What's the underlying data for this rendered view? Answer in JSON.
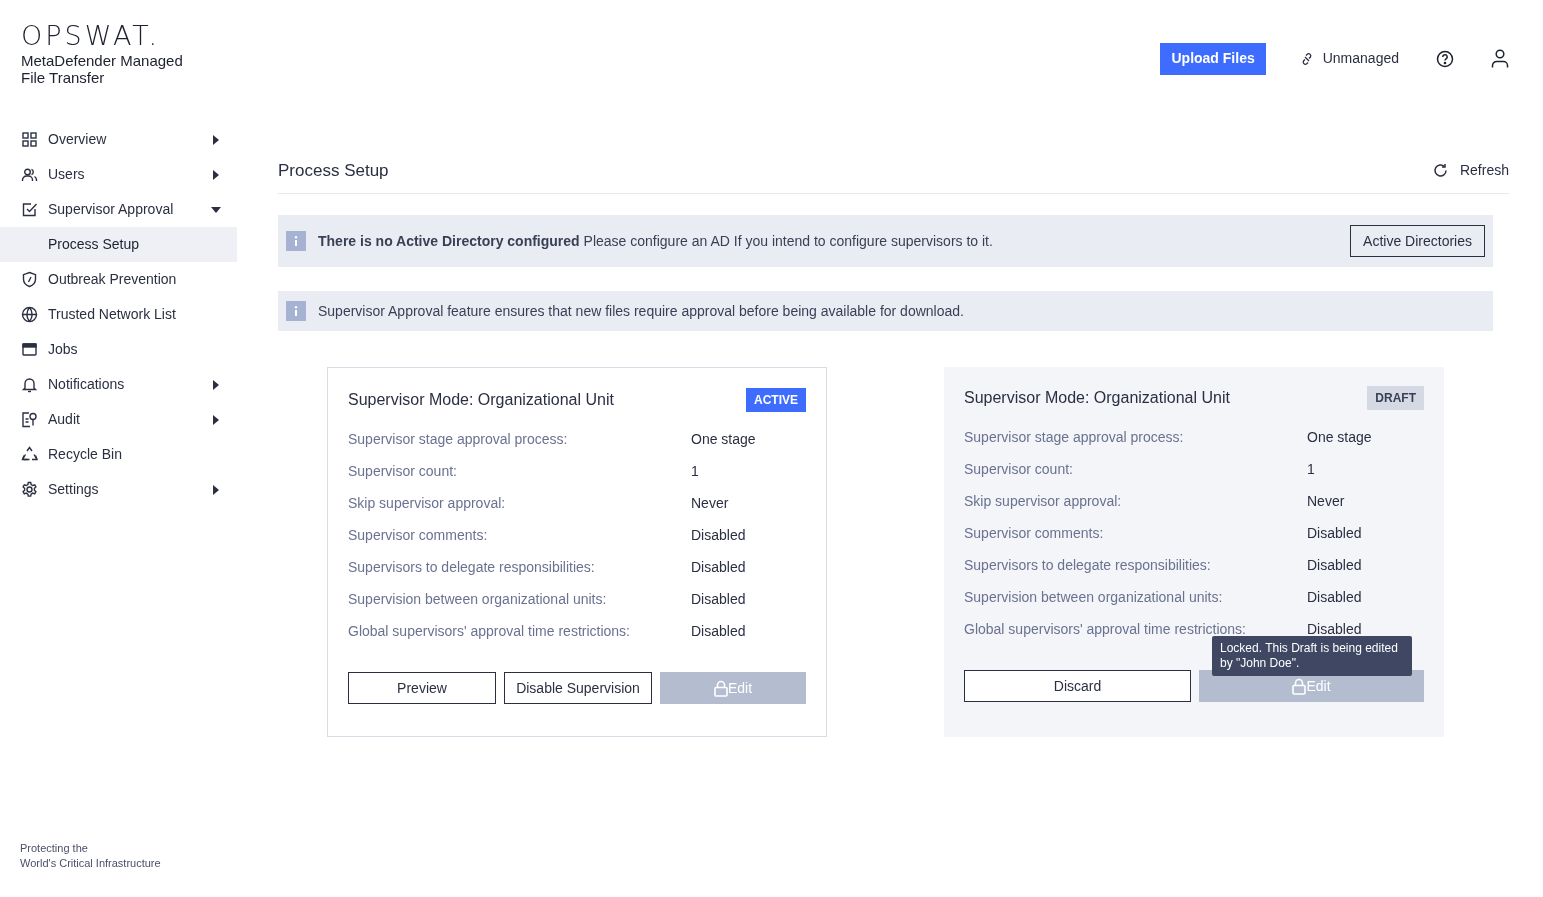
{
  "brand": {
    "logo": "OPSWAT.",
    "product": "MetaDefender Managed File Transfer",
    "tagline": [
      "Protecting the",
      "World's Critical Infrastructure"
    ]
  },
  "header": {
    "upload_button": "Upload Files",
    "status": "Unmanaged"
  },
  "sidebar": {
    "items": [
      {
        "label": "Overview",
        "selected": false,
        "expanded": false
      },
      {
        "label": "Users",
        "selected": false,
        "expanded": false
      },
      {
        "label": "Supervisor Approval",
        "selected": false,
        "expanded": true,
        "children": [
          {
            "label": "Process Setup",
            "selected": true
          }
        ]
      },
      {
        "label": "Outbreak Prevention",
        "selected": false
      },
      {
        "label": "Trusted Network List",
        "selected": false
      },
      {
        "label": "Jobs",
        "selected": false
      },
      {
        "label": "Notifications",
        "selected": false,
        "expanded": false
      },
      {
        "label": "Audit",
        "selected": false,
        "expanded": false
      },
      {
        "label": "Recycle Bin",
        "selected": false
      },
      {
        "label": "Settings",
        "selected": false,
        "expanded": false
      }
    ]
  },
  "page": {
    "title": "Process Setup",
    "refresh": "Refresh"
  },
  "alerts": [
    {
      "text": "**There is no Active Directory configured** Please configure an AD If you intend to configure supervisors to it.",
      "button": "Active Directories"
    },
    {
      "text": "Supervisor Approval feature ensures that new files require approval before being available for download."
    }
  ],
  "cards": [
    {
      "kind": "active",
      "title": "Supervisor Mode: Organizational Unit",
      "badge": "ACTIVE",
      "rows": [
        {
          "label": "Supervisor stage approval process:",
          "value": "One stage"
        },
        {
          "label": "Supervisor count:",
          "value": "1"
        },
        {
          "label": "Skip supervisor approval:",
          "value": "Never"
        },
        {
          "label": "Supervisor comments:",
          "value": "Disabled"
        },
        {
          "label": "Supervisors to delegate responsibilities:",
          "value": "Disabled"
        },
        {
          "label": "Supervision between organizational units:",
          "value": "Disabled"
        },
        {
          "label": "Global supervisors' approval time restrictions:",
          "value": "Disabled"
        }
      ],
      "buttons": [
        {
          "label": "Preview",
          "disabled": false,
          "locked": false
        },
        {
          "label": "Disable Supervision",
          "disabled": false,
          "locked": false
        },
        {
          "label": "Edit",
          "disabled": true,
          "locked": true
        }
      ]
    },
    {
      "kind": "draft",
      "title": "Supervisor Mode: Organizational Unit",
      "badge": "DRAFT",
      "tooltip": "Locked. This Draft is being edited by \"John Doe\".",
      "rows": [
        {
          "label": "Supervisor stage approval process:",
          "value": "One stage"
        },
        {
          "label": "Supervisor count:",
          "value": "1"
        },
        {
          "label": "Skip supervisor approval:",
          "value": "Never"
        },
        {
          "label": "Supervisor comments:",
          "value": "Disabled"
        },
        {
          "label": "Supervisors to delegate responsibilities:",
          "value": "Disabled"
        },
        {
          "label": "Supervision between organizational units:",
          "value": "Disabled"
        },
        {
          "label": "Global supervisors' approval time restrictions:",
          "value": "Disabled"
        }
      ],
      "buttons": [
        {
          "label": "Discard",
          "disabled": false,
          "locked": false
        },
        {
          "label": "Edit",
          "disabled": true,
          "locked": true
        }
      ]
    }
  ]
}
